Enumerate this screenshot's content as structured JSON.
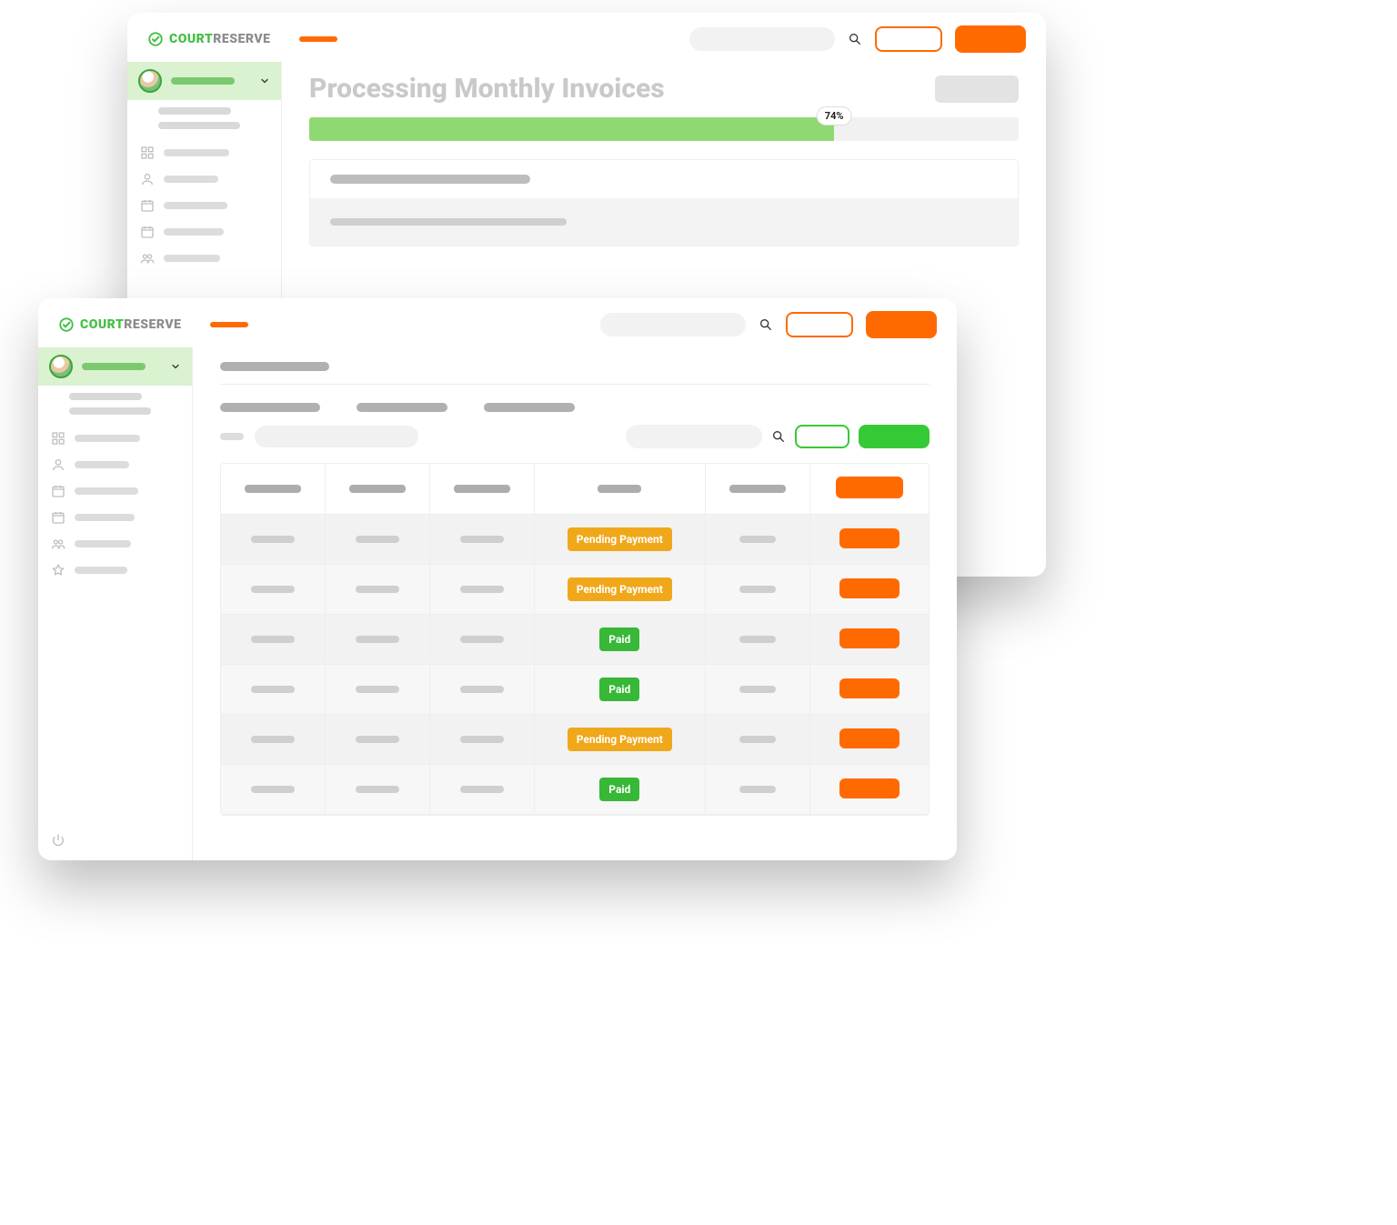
{
  "logo": {
    "court": "COURT",
    "reserve": "RESERVE"
  },
  "back": {
    "title": "Processing Monthly Invoices",
    "progress": {
      "pct": 74,
      "label": "74%"
    }
  },
  "front": {
    "statuses": {
      "pending": "Pending Payment",
      "paid": "Paid"
    },
    "rows": [
      {
        "status": "pending"
      },
      {
        "status": "pending"
      },
      {
        "status": "paid"
      },
      {
        "status": "paid"
      },
      {
        "status": "pending"
      },
      {
        "status": "paid"
      }
    ]
  }
}
